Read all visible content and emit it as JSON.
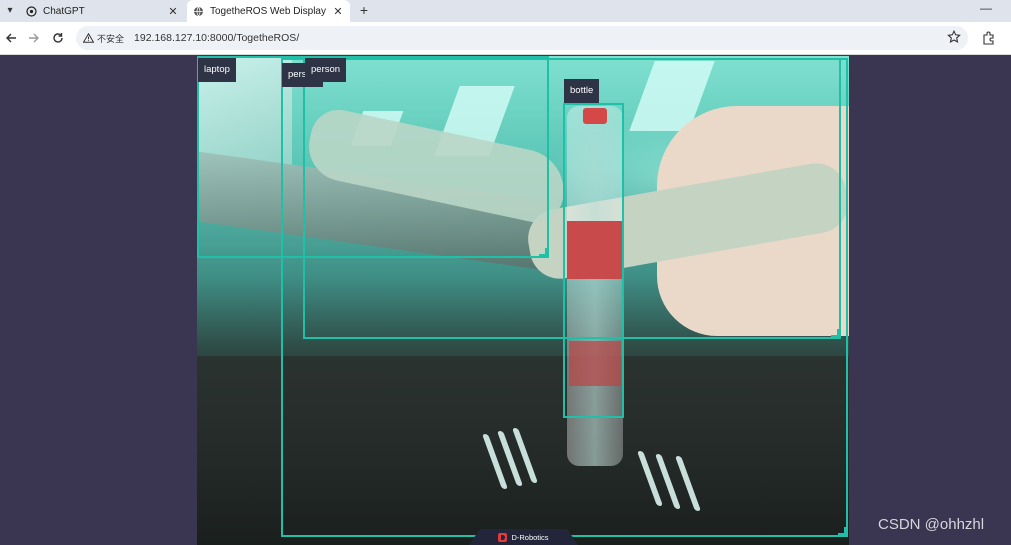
{
  "browser": {
    "tabs": [
      {
        "title": "ChatGPT",
        "active": false
      },
      {
        "title": "TogetheROS Web Display",
        "active": true
      }
    ],
    "new_tab_label": "+",
    "minimize_label": "—",
    "address_bar": {
      "security_label": "不安全",
      "url": "192.168.127.10:8000/TogetheROS/"
    }
  },
  "detections": [
    {
      "label": "laptop"
    },
    {
      "label": "person"
    },
    {
      "label": "person"
    },
    {
      "label": "bottle"
    }
  ],
  "footer": {
    "brand": "D-Robotics"
  },
  "watermark": "CSDN @ohhzhl",
  "colors": {
    "bbox": "#1fbfa8",
    "label_bg": "#2e3446",
    "page_bg": "#3a3550"
  }
}
